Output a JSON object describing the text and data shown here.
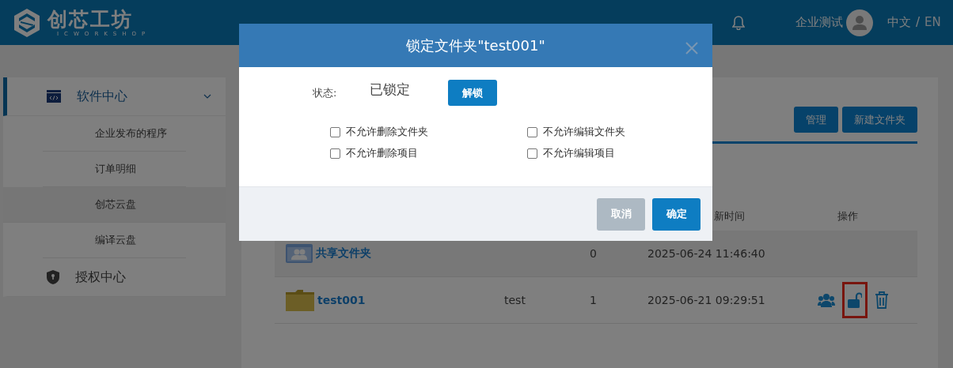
{
  "header": {
    "logo": {
      "name": "创芯工坊",
      "sub": "ICWORKSHOP"
    },
    "user": "企业测试",
    "languages": [
      {
        "label": "中文",
        "selected": true
      },
      {
        "label": "EN",
        "selected": false
      }
    ],
    "language_separator": "/"
  },
  "sidebar": {
    "groups": [
      {
        "label": "软件中心",
        "kind": "code",
        "active": true,
        "expanded": true,
        "children": [
          {
            "label": "企业发布的程序",
            "selected": false
          },
          {
            "label": "订单明细",
            "selected": false
          },
          {
            "label": "创芯云盘",
            "selected": true
          },
          {
            "label": "编译云盘",
            "selected": false
          }
        ]
      },
      {
        "label": "授权中心",
        "kind": "shield",
        "active": false
      }
    ]
  },
  "toolbar": {
    "buttons": [
      "管理",
      "新建文件夹"
    ]
  },
  "table": {
    "columns": [
      {
        "label": "新时间"
      },
      {
        "label": "操作"
      }
    ],
    "rows": [
      {
        "kind": "shared",
        "name": "共享文件夹",
        "count": "0",
        "time": "2025-06-24 11:46:40"
      },
      {
        "kind": "folder",
        "name": "test001",
        "owner": "test",
        "count": "1",
        "time": "2025-06-21 09:29:51",
        "actions": [
          {
            "kind": "share",
            "highlighted": false
          },
          {
            "kind": "unlock",
            "highlighted": true
          },
          {
            "kind": "delete",
            "highlighted": false
          }
        ]
      }
    ]
  },
  "dialog": {
    "title": "锁定文件夹\"test001\"",
    "status_label": "状态:",
    "status_value": "已锁定",
    "unlock_button": "解锁",
    "options": [
      {
        "label": "不允许删除文件夹",
        "checked": false
      },
      {
        "label": "不允许编辑文件夹",
        "checked": false
      },
      {
        "label": "不允许删除项目",
        "checked": false
      },
      {
        "label": "不允许编辑项目",
        "checked": false
      }
    ],
    "buttons": [
      {
        "label": "取消",
        "kind": "cancel"
      },
      {
        "label": "确定",
        "kind": "primary"
      }
    ]
  }
}
